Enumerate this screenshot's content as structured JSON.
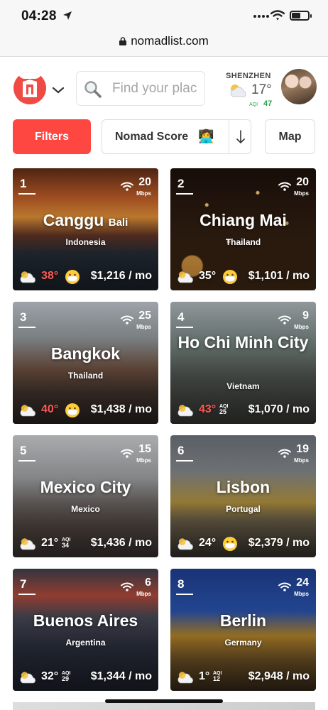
{
  "status_bar": {
    "time": "04:28"
  },
  "browser": {
    "url": "nomadlist.com"
  },
  "header": {
    "search_placeholder": "Find your plac",
    "weather": {
      "city": "SHENZHEN",
      "temp": "17°",
      "aqi_label": "AQI",
      "aqi_value": "47"
    }
  },
  "toolbar": {
    "filters_label": "Filters",
    "sort_label": "Nomad Score",
    "sort_emoji": "👩‍💻",
    "sort_dir": "↓",
    "map_label": "Map"
  },
  "cities": [
    {
      "rank": "1",
      "name": "Canggu",
      "sub": "Bali",
      "country": "Indonesia",
      "speed": "20",
      "speed_unit": "Mbps",
      "temp": "38°",
      "hot": true,
      "aqi": "",
      "mask": true,
      "cost": "$1,216 / mo"
    },
    {
      "rank": "2",
      "name": "Chiang Mai",
      "sub": "",
      "country": "Thailand",
      "speed": "20",
      "speed_unit": "Mbps",
      "temp": "35°",
      "hot": false,
      "aqi": "",
      "mask": true,
      "cost": "$1,101 / mo"
    },
    {
      "rank": "3",
      "name": "Bangkok",
      "sub": "",
      "country": "Thailand",
      "speed": "25",
      "speed_unit": "Mbps",
      "temp": "40°",
      "hot": true,
      "aqi": "",
      "mask": true,
      "cost": "$1,438 / mo"
    },
    {
      "rank": "4",
      "name": "Ho Chi Minh City",
      "sub": "",
      "country": "Vietnam",
      "speed": "9",
      "speed_unit": "Mbps",
      "temp": "43°",
      "hot": true,
      "aqi": "25",
      "mask": false,
      "cost": "$1,070 / mo"
    },
    {
      "rank": "5",
      "name": "Mexico City",
      "sub": "",
      "country": "Mexico",
      "speed": "15",
      "speed_unit": "Mbps",
      "temp": "21°",
      "hot": false,
      "aqi": "34",
      "mask": false,
      "cost": "$1,436 / mo"
    },
    {
      "rank": "6",
      "name": "Lisbon",
      "sub": "",
      "country": "Portugal",
      "speed": "19",
      "speed_unit": "Mbps",
      "temp": "24°",
      "hot": false,
      "aqi": "",
      "mask": true,
      "cost": "$2,379 / mo"
    },
    {
      "rank": "7",
      "name": "Buenos Aires",
      "sub": "",
      "country": "Argentina",
      "speed": "6",
      "speed_unit": "Mbps",
      "temp": "32°",
      "hot": false,
      "aqi": "29",
      "mask": false,
      "cost": "$1,344 / mo"
    },
    {
      "rank": "8",
      "name": "Berlin",
      "sub": "",
      "country": "Germany",
      "speed": "24",
      "speed_unit": "Mbps",
      "temp": "1°",
      "hot": false,
      "aqi": "12",
      "mask": false,
      "cost": "$2,948 / mo"
    }
  ],
  "colors": {
    "accent": "#ff4742",
    "hot_temp": "#ff5a55",
    "aqi_good": "#2aa34a"
  }
}
